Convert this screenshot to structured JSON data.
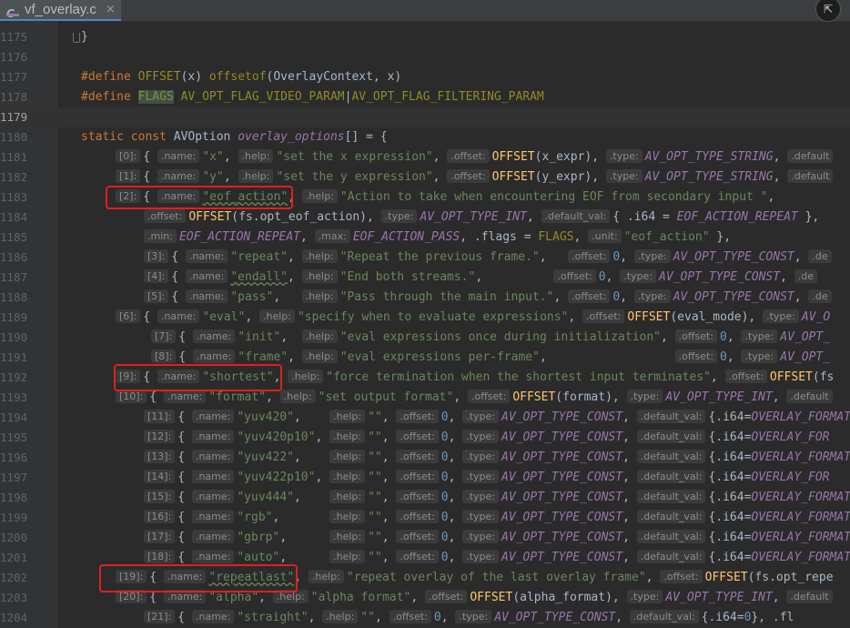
{
  "tab": {
    "filename": "vf_overlay.c",
    "close": "×"
  },
  "corner_button": "⇱",
  "lines": [
    {
      "num": "1175",
      "code": "}"
    },
    {
      "num": "1176",
      "code": ""
    },
    {
      "num": "1177",
      "code": "#define OFFSET(x) offsetof(OverlayContext, x)"
    },
    {
      "num": "1178",
      "code": "#define FLAGS AV_OPT_FLAG_VIDEO_PARAM|AV_OPT_FLAG_FILTERING_PARAM"
    },
    {
      "num": "1179",
      "code": ""
    },
    {
      "num": "1180",
      "code": "static const AVOption overlay_options[] = {"
    },
    {
      "num": "1181",
      "code": "[0]: { .name: \"x\", .help: \"set the x expression\", .offset: OFFSET(x_expr), .type: AV_OPT_TYPE_STRING, .default"
    },
    {
      "num": "1182",
      "code": "[1]: { .name: \"y\", .help: \"set the y expression\", .offset: OFFSET(y_expr), .type: AV_OPT_TYPE_STRING, .default"
    },
    {
      "num": "1183",
      "code": "[2]: { .name: \"eof_action\", .help: \"Action to take when encountering EOF from secondary input \","
    },
    {
      "num": "1184",
      "code": ".offset: OFFSET(fs.opt_eof_action), .type: AV_OPT_TYPE_INT, .default_val: { .i64 = EOF_ACTION_REPEAT },"
    },
    {
      "num": "1185",
      "code": ".min: EOF_ACTION_REPEAT, .max: EOF_ACTION_PASS, .flags = FLAGS, .unit: \"eof_action\" },"
    },
    {
      "num": "1186",
      "code": "[3]: { .name: \"repeat\", .help: \"Repeat the previous frame.\", .offset: 0, .type: AV_OPT_TYPE_CONST, .de"
    },
    {
      "num": "1187",
      "code": "[4]: { .name: \"endall\", .help: \"End both streams.\", .offset: 0, .type: AV_OPT_TYPE_CONST, .de"
    },
    {
      "num": "1188",
      "code": "[5]: { .name: \"pass\", .help: \"Pass through the main input.\", .offset: 0, .type: AV_OPT_TYPE_CONST, .de"
    },
    {
      "num": "1189",
      "code": "[6]: { .name: \"eval\", .help: \"specify when to evaluate expressions\", .offset: OFFSET(eval_mode), .type: AV_O"
    },
    {
      "num": "1190",
      "code": "[7]: { .name: \"init\", .help: \"eval expressions once during initialization\", .offset: 0, .type: AV_OPT_"
    },
    {
      "num": "1191",
      "code": "[8]: { .name: \"frame\", .help: \"eval expressions per-frame\", .offset: 0, .type: AV_OPT_"
    },
    {
      "num": "1192",
      "code": "[9]: { .name: \"shortest\", .help: \"force termination when the shortest input terminates\", .offset: OFFSET(fs"
    },
    {
      "num": "1193",
      "code": "[10]: { .name: \"format\", .help: \"set output format\", .offset: OFFSET(format), .type: AV_OPT_TYPE_INT, .default"
    },
    {
      "num": "1194",
      "code": "[11]: { .name: \"yuv420\", .help: \"\", .offset: 0, .type: AV_OPT_TYPE_CONST, .default_val: {.i64=OVERLAY_FORMAT"
    },
    {
      "num": "1195",
      "code": "[12]: { .name: \"yuv420p10\", .help: \"\", .offset: 0, .type: AV_OPT_TYPE_CONST, .default_val: {.i64=OVERLAY_FOR"
    },
    {
      "num": "1196",
      "code": "[13]: { .name: \"yuv422\", .help: \"\", .offset: 0, .type: AV_OPT_TYPE_CONST, .default_val: {.i64=OVERLAY_FORMAT"
    },
    {
      "num": "1197",
      "code": "[14]: { .name: \"yuv422p10\", .help: \"\", .offset: 0, .type: AV_OPT_TYPE_CONST, .default_val: {.i64=OVERLAY_FOR"
    },
    {
      "num": "1198",
      "code": "[15]: { .name: \"yuv444\", .help: \"\", .offset: 0, .type: AV_OPT_TYPE_CONST, .default_val: {.i64=OVERLAY_FORMAT"
    },
    {
      "num": "1199",
      "code": "[16]: { .name: \"rgb\", .help: \"\", .offset: 0, .type: AV_OPT_TYPE_CONST, .default_val: {.i64=OVERLAY_FORMAT"
    },
    {
      "num": "1200",
      "code": "[17]: { .name: \"gbrp\", .help: \"\", .offset: 0, .type: AV_OPT_TYPE_CONST, .default_val: {.i64=OVERLAY_FORMAT"
    },
    {
      "num": "1201",
      "code": "[18]: { .name: \"auto\", .help: \"\", .offset: 0, .type: AV_OPT_TYPE_CONST, .default_val: {.i64=OVERLAY_FORMAT"
    },
    {
      "num": "1202",
      "code": "[19]: { .name: \"repeatlast\", .help: \"repeat overlay of the last overlay frame\", .offset: OFFSET(fs.opt_repe"
    },
    {
      "num": "1203",
      "code": "[20]: { .name: \"alpha\", .help: \"alpha format\", .offset: OFFSET(alpha_format), .type: AV_OPT_TYPE_INT, .default"
    },
    {
      "num": "1204",
      "code": "[21]: { .name: \"straight\", .help: \"\", .offset: 0, .type: AV_OPT_TYPE_CONST, .default_val: {.i64=0}, .fl"
    }
  ]
}
